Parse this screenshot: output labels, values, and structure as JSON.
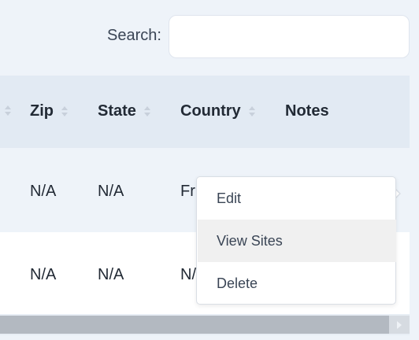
{
  "search": {
    "label": "Search:",
    "value": "",
    "placeholder": ""
  },
  "table": {
    "columns": [
      {
        "label": "Zip",
        "sortable": true
      },
      {
        "label": "State",
        "sortable": true
      },
      {
        "label": "Country",
        "sortable": true
      },
      {
        "label": "Notes",
        "sortable": false
      }
    ],
    "rows": [
      {
        "zip": "N/A",
        "state": "N/A",
        "country": "Fr"
      },
      {
        "zip": "N/A",
        "state": "N/A",
        "country": "N/"
      }
    ]
  },
  "context_menu": {
    "items": [
      {
        "label": "Edit"
      },
      {
        "label": "View Sites",
        "highlighted": true
      },
      {
        "label": "Delete"
      }
    ]
  },
  "icons": {
    "sort": "sort-arrows-icon",
    "scroll_right": "chevron-right-icon",
    "menu_pointer": "caret-right-icon"
  },
  "colors": {
    "header_bg": "#e2eaf3",
    "row_alt_bg": "#eef3f9",
    "menu_highlight": "#f0f0f0",
    "scroll_thumb": "#b3b9c1"
  }
}
